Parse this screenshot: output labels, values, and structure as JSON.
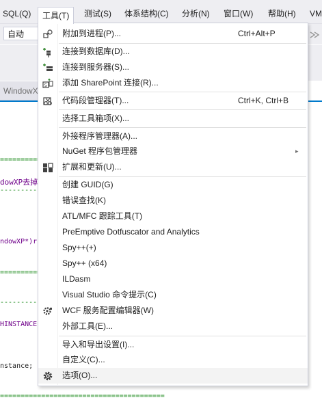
{
  "menubar": {
    "items": [
      {
        "label": "SQL(Q)"
      },
      {
        "label": "工具(T)"
      },
      {
        "label": "测试(S)"
      },
      {
        "label": "体系结构(C)"
      },
      {
        "label": "分析(N)"
      },
      {
        "label": "窗口(W)"
      },
      {
        "label": "帮助(H)"
      },
      {
        "label": "VM"
      }
    ]
  },
  "toolbar": {
    "combo_value": "自动"
  },
  "document_tab": {
    "label": "WindowX"
  },
  "editor": {
    "lines": [
      "=============",
      "dowXP去掉",
      "-------------",
      "ndowXP*)r",
      "=============",
      "-------------",
      "HINSTANCE",
      "nstance;",
      "========================================"
    ]
  },
  "menu": {
    "items": [
      {
        "label": "附加到进程(P)...",
        "shortcut": "Ctrl+Alt+P",
        "icon": "attach-process-icon"
      },
      {
        "label": "连接到数据库(D)...",
        "shortcut": "",
        "icon": "connect-database-icon"
      },
      {
        "label": "连接到服务器(S)...",
        "shortcut": "",
        "icon": "connect-server-icon"
      },
      {
        "label": "添加 SharePoint 连接(R)...",
        "shortcut": "",
        "icon": "sharepoint-icon"
      },
      {
        "label": "代码段管理器(T)...",
        "shortcut": "Ctrl+K, Ctrl+B",
        "icon": "snippet-manager-icon"
      },
      {
        "label": "选择工具箱项(X)...",
        "shortcut": "",
        "icon": ""
      },
      {
        "label": "外接程序管理器(A)...",
        "shortcut": "",
        "icon": ""
      },
      {
        "label": "NuGet 程序包管理器",
        "shortcut": "",
        "icon": "",
        "submenu": true
      },
      {
        "label": "扩展和更新(U)...",
        "shortcut": "",
        "icon": "extensions-icon"
      },
      {
        "label": "创建 GUID(G)",
        "shortcut": "",
        "icon": ""
      },
      {
        "label": "错误查找(K)",
        "shortcut": "",
        "icon": ""
      },
      {
        "label": "ATL/MFC 跟踪工具(T)",
        "shortcut": "",
        "icon": ""
      },
      {
        "label": "PreEmptive Dotfuscator and Analytics",
        "shortcut": "",
        "icon": ""
      },
      {
        "label": "Spy++(+)",
        "shortcut": "",
        "icon": ""
      },
      {
        "label": "Spy++ (x64)",
        "shortcut": "",
        "icon": ""
      },
      {
        "label": "ILDasm",
        "shortcut": "",
        "icon": ""
      },
      {
        "label": "Visual Studio 命令提示(C)",
        "shortcut": "",
        "icon": ""
      },
      {
        "label": "WCF 服务配置编辑器(W)",
        "shortcut": "",
        "icon": "wcf-config-icon"
      },
      {
        "label": "外部工具(E)...",
        "shortcut": "",
        "icon": ""
      },
      {
        "label": "导入和导出设置(I)...",
        "shortcut": "",
        "icon": ""
      },
      {
        "label": "自定义(C)...",
        "shortcut": "",
        "icon": ""
      },
      {
        "label": "选项(O)...",
        "shortcut": "",
        "icon": "options-gear-icon"
      }
    ]
  },
  "colors": {
    "menubar_bg": "#eeeef2",
    "menu_border": "#cccedb",
    "accent": "#007acc",
    "hover_bg": "#f3f3f3"
  }
}
